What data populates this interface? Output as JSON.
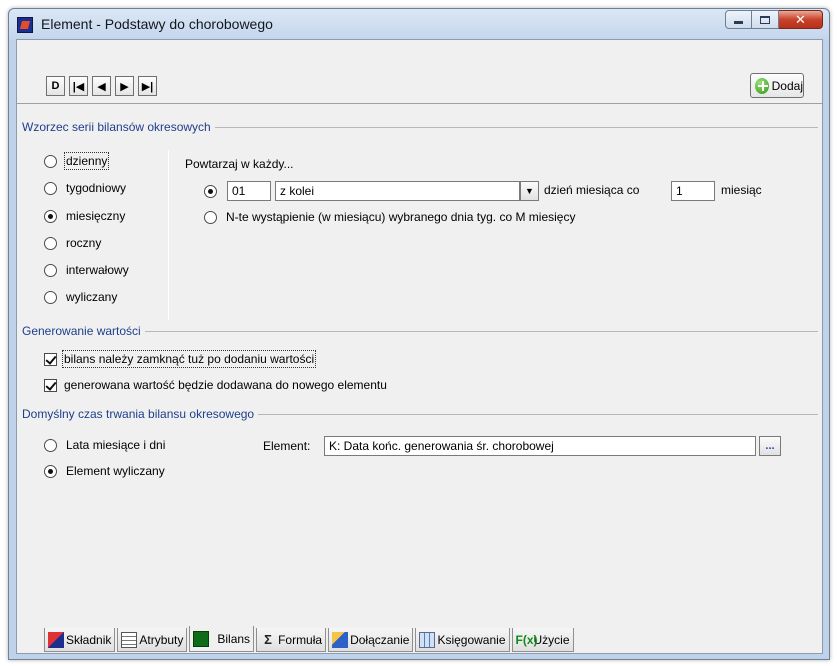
{
  "window": {
    "title": "Element - Podstawy do chorobowego"
  },
  "toolbar": {
    "nav": [
      "D",
      "|◀",
      "◀",
      "▶",
      "▶|"
    ],
    "add_label": "Dodaj"
  },
  "pattern": {
    "title": "Wzorzec serii bilansów okresowych",
    "options": [
      "dzienny",
      "tygodniowy",
      "miesięczny",
      "roczny",
      "interwałowy",
      "wyliczany"
    ],
    "selected": "miesięczny",
    "repeat_label": "Powtarzaj w każdy...",
    "day_value": "01",
    "order_value": "z kolei",
    "day_of_month_label": "dzień miesiąca co",
    "months_value": "1",
    "months_label": "miesiąc",
    "nth_label": "N-te wystąpienie (w miesiącu) wybranego dnia tyg. co M miesięcy"
  },
  "generation": {
    "title": "Generowanie wartości",
    "close_after_add": "bilans należy zamknąć tuż po dodaniu wartości",
    "add_to_new_element": "generowana wartość będzie dodawana do nowego elementu"
  },
  "duration": {
    "title": "Domyślny czas trwania bilansu okresowego",
    "opt_years": "Lata miesiące i dni",
    "opt_computed": "Element wyliczany",
    "element_label": "Element:",
    "element_value": "K: Data końc. generowania śr. chorobowej",
    "browse_label": "..."
  },
  "tabs": [
    {
      "label": "Składnik",
      "icon": "skladnik-icon"
    },
    {
      "label": "Atrybuty",
      "icon": "atrybuty-icon"
    },
    {
      "label": "Bilans",
      "icon": "bilans-icon"
    },
    {
      "label": "Formuła",
      "icon": "formula-icon"
    },
    {
      "label": "Dołączanie",
      "icon": "dolaczanie-icon"
    },
    {
      "label": "Księgowanie",
      "icon": "ksiegowanie-icon"
    },
    {
      "label": "Użycie",
      "icon": "uzycie-icon"
    }
  ],
  "active_tab": "Bilans",
  "colors": {
    "group_title": "#1d3f8c",
    "close_button": "#c8432a"
  }
}
